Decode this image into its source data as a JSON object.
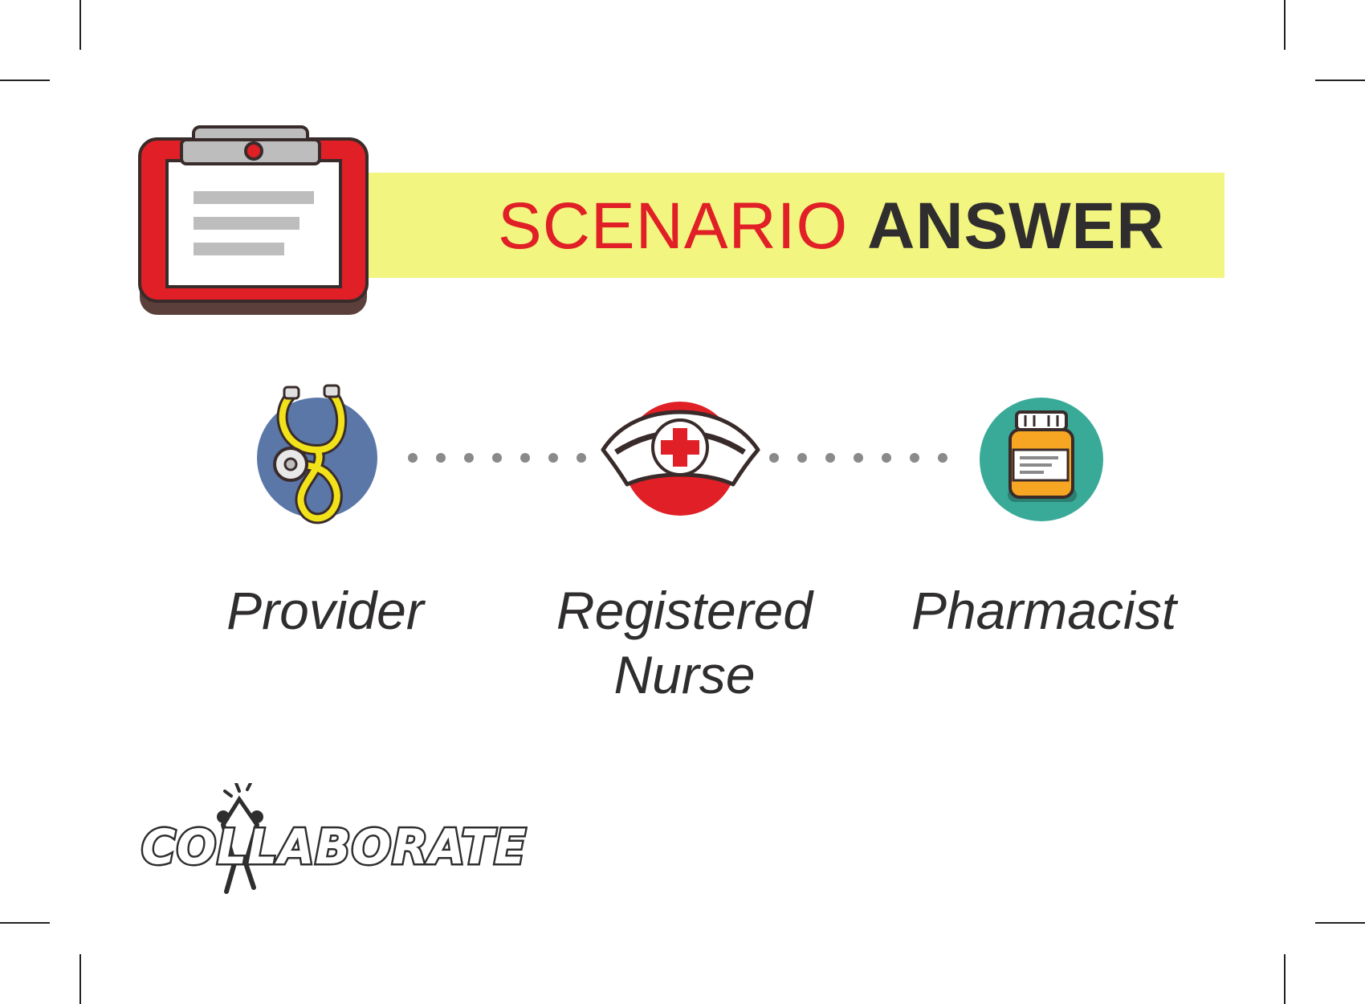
{
  "title": {
    "part1": "SCENARIO",
    "part2": "ANSWER"
  },
  "roles": [
    {
      "label": "Provider",
      "icon": "stethoscope-icon"
    },
    {
      "label": "Registered Nurse",
      "icon": "nurse-cap-icon"
    },
    {
      "label": "Pharmacist",
      "icon": "pill-bottle-icon"
    }
  ],
  "logo": {
    "text": "COLLABORATE"
  },
  "colors": {
    "red": "#e01f26",
    "banner_yellow": "#f2f57f",
    "provider_blue": "#5a77a8",
    "pharmacist_teal": "#3aaa98",
    "dark": "#2f2d2e"
  }
}
